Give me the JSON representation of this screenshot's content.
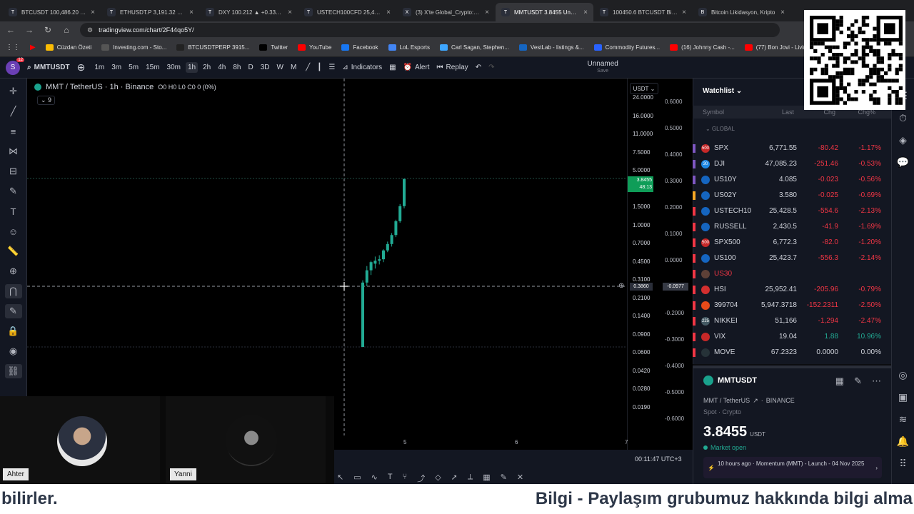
{
  "browser": {
    "tabs": [
      {
        "label": "BTCUSDT 100,486.20 ▼ -",
        "icon": "T"
      },
      {
        "label": "ETHUSDT.P 3,191.32 ▼ -",
        "icon": "T"
      },
      {
        "label": "DXY 100.212 ▲ +0.33% U",
        "icon": "T"
      },
      {
        "label": "USTECH100CFD 25,428.5",
        "icon": "T"
      },
      {
        "label": "(3) X'te Global_Crypto: \"@",
        "icon": "X"
      },
      {
        "label": "MMTUSDT 3.8455 Unnam",
        "icon": "T"
      },
      {
        "label": "100450.6 BTCUSDT Binan",
        "icon": "T"
      },
      {
        "label": "Bitcoin Likidasyon, Kripto",
        "icon": "B"
      }
    ],
    "url": "tradingview.com/chart/2F44qo5Y/",
    "bookmarks": [
      "Cüzdan Özeti",
      "Investing.com - Sto...",
      "BTCUSDTPERP 3915...",
      "Twitter",
      "YouTube",
      "Facebook",
      "LoL Esports",
      "Carl Sagan, Stephen...",
      "VestLab - listings &...",
      "Commodity Futures...",
      "(16) Johnny Cash -...",
      "(77) Bon Jovi - Livin..."
    ],
    "profile_badge": "12",
    "profile_letter": "S"
  },
  "toolbar": {
    "symbol": "MMTUSDT",
    "timeframes": [
      "1m",
      "3m",
      "5m",
      "15m",
      "30m",
      "1h",
      "2h",
      "4h",
      "8h",
      "D",
      "3D",
      "W",
      "M"
    ],
    "active_timeframe": "1h",
    "indicators_label": "Indicators",
    "alert_label": "Alert",
    "replay_label": "Replay",
    "layout_name": "Unnamed",
    "layout_status": "Save"
  },
  "chart_legend": {
    "title": "MMT / TetherUS · 1h · Binance",
    "ohlc": "O0 H0 L0 C0 0 (0%)",
    "indicator_count": "9",
    "currency": "USDT"
  },
  "chart_data": {
    "type": "candlestick",
    "left_axis_ticks": [
      "24.0000",
      "16.0000",
      "11.0000",
      "7.5000",
      "5.0000",
      "2.3000",
      "1.5000",
      "1.0000",
      "0.7000",
      "0.4500",
      "0.3100",
      "0.2100",
      "0.1400",
      "0.0900",
      "0.0600",
      "0.0420",
      "0.0280",
      "0.0190"
    ],
    "right_axis_ticks": [
      "0.6000",
      "0.5000",
      "0.4000",
      "0.3000",
      "0.2000",
      "0.1000",
      "0.0000",
      "-0.1000",
      "-0.2000",
      "-0.3000",
      "-0.4000",
      "-0.5000",
      "-0.6000"
    ],
    "x_ticks": [
      "5",
      "6",
      "7"
    ],
    "last_price": "3.8455",
    "countdown": "48:13",
    "crosshair_price": "0.3860",
    "crosshair_right": "-0.0977",
    "candles": [
      {
        "o": 0.09,
        "h": 0.4,
        "l": 0.09,
        "c": 0.38
      },
      {
        "o": 0.38,
        "h": 0.55,
        "l": 0.35,
        "c": 0.5
      },
      {
        "o": 0.5,
        "h": 0.62,
        "l": 0.45,
        "c": 0.6
      },
      {
        "o": 0.58,
        "h": 0.68,
        "l": 0.52,
        "c": 0.62
      },
      {
        "o": 0.62,
        "h": 0.7,
        "l": 0.57,
        "c": 0.64
      },
      {
        "o": 0.64,
        "h": 0.8,
        "l": 0.6,
        "c": 0.78
      },
      {
        "o": 0.78,
        "h": 0.95,
        "l": 0.75,
        "c": 0.9
      },
      {
        "o": 0.9,
        "h": 1.15,
        "l": 0.85,
        "c": 1.1
      },
      {
        "o": 1.1,
        "h": 1.55,
        "l": 1.05,
        "c": 1.5
      },
      {
        "o": 1.5,
        "h": 2.2,
        "l": 1.45,
        "c": 2.1
      },
      {
        "o": 2.1,
        "h": 3.9,
        "l": 2.0,
        "c": 3.85
      }
    ],
    "utc_clock": "00:11:47 UTC+3"
  },
  "video": {
    "left_name": "Ahter",
    "right_name": "Yanni"
  },
  "watchlist": {
    "title": "Watchlist",
    "columns": [
      "Symbol",
      "Last",
      "Chg",
      "Chg%"
    ],
    "group": "GLOBAL",
    "rows": [
      {
        "sym": "SPX",
        "last": "6,771.55",
        "chg": "-80.42",
        "pct": "-1.17%",
        "bar": "#7e57c2",
        "flag": "#c62828",
        "flagtxt": "500",
        "dir": "red"
      },
      {
        "sym": "DJI",
        "last": "47,085.23",
        "chg": "-251.46",
        "pct": "-0.53%",
        "bar": "#7e57c2",
        "flag": "#1e88e5",
        "flagtxt": "30",
        "dir": "red"
      },
      {
        "sym": "US10Y",
        "last": "4.085",
        "chg": "-0.023",
        "pct": "-0.56%",
        "bar": "#7e57c2",
        "flag": "#1565c0",
        "flagtxt": "",
        "dir": "red"
      },
      {
        "sym": "US02Y",
        "last": "3.580",
        "chg": "-0.025",
        "pct": "-0.69%",
        "bar": "#f9a825",
        "flag": "#1565c0",
        "flagtxt": "",
        "dir": "red"
      },
      {
        "sym": "USTECH10",
        "last": "25,428.5",
        "chg": "-554.6",
        "pct": "-2.13%",
        "bar": "#f23645",
        "flag": "#1565c0",
        "flagtxt": "",
        "dir": "red"
      },
      {
        "sym": "RUSSELL",
        "last": "2,430.5",
        "chg": "-41.9",
        "pct": "-1.69%",
        "bar": "#f23645",
        "flag": "#1565c0",
        "flagtxt": "",
        "dir": "red"
      },
      {
        "sym": "SPX500",
        "last": "6,772.3",
        "chg": "-82.0",
        "pct": "-1.20%",
        "bar": "#f23645",
        "flag": "#c62828",
        "flagtxt": "500",
        "dir": "red"
      },
      {
        "sym": "US100",
        "last": "25,423.7",
        "chg": "-556.3",
        "pct": "-2.14%",
        "bar": "#f23645",
        "flag": "#1565c0",
        "flagtxt": "",
        "dir": "red"
      },
      {
        "sym": "US30",
        "last": "",
        "chg": "",
        "pct": "",
        "bar": "#f23645",
        "flag": "#5d4037",
        "flagtxt": "",
        "dir": "red"
      },
      {
        "sym": "HSI",
        "last": "25,952.41",
        "chg": "-205.96",
        "pct": "-0.79%",
        "bar": "#f23645",
        "flag": "#d32f2f",
        "flagtxt": "",
        "dir": "red"
      },
      {
        "sym": "399704",
        "last": "5,947.3718",
        "chg": "-152.2311",
        "pct": "-2.50%",
        "bar": "#f23645",
        "flag": "#e64a19",
        "flagtxt": "",
        "dir": "red"
      },
      {
        "sym": "NIKKEI",
        "last": "51,166",
        "chg": "-1,294",
        "pct": "-2.47%",
        "bar": "#f23645",
        "flag": "#455a64",
        "flagtxt": "225",
        "dir": "red"
      },
      {
        "sym": "VIX",
        "last": "19.04",
        "chg": "1.88",
        "pct": "10.96%",
        "bar": "#f23645",
        "flag": "#c62828",
        "flagtxt": "",
        "dir": "green"
      },
      {
        "sym": "MOVE",
        "last": "67.2323",
        "chg": "0.0000",
        "pct": "0.00%",
        "bar": "#f23645",
        "flag": "#263238",
        "flagtxt": "",
        "dir": "white"
      }
    ]
  },
  "detail": {
    "symbol": "MMTUSDT",
    "name": "MMT / TetherUS",
    "exchange": "BINANCE",
    "category": "Spot · Crypto",
    "price": "3.8455",
    "currency": "USDT",
    "status": "Market open",
    "news": "10 hours ago · Momentum (MMT) - Launch - 04 Nov 2025"
  },
  "ticker": {
    "left": "bilirler.",
    "right": "Bilgi - Paylaşım grubumuz hakkında bilgi alma"
  },
  "colors": {
    "up": "#22ab94",
    "down": "#f23645",
    "accent": "#2962ff"
  }
}
